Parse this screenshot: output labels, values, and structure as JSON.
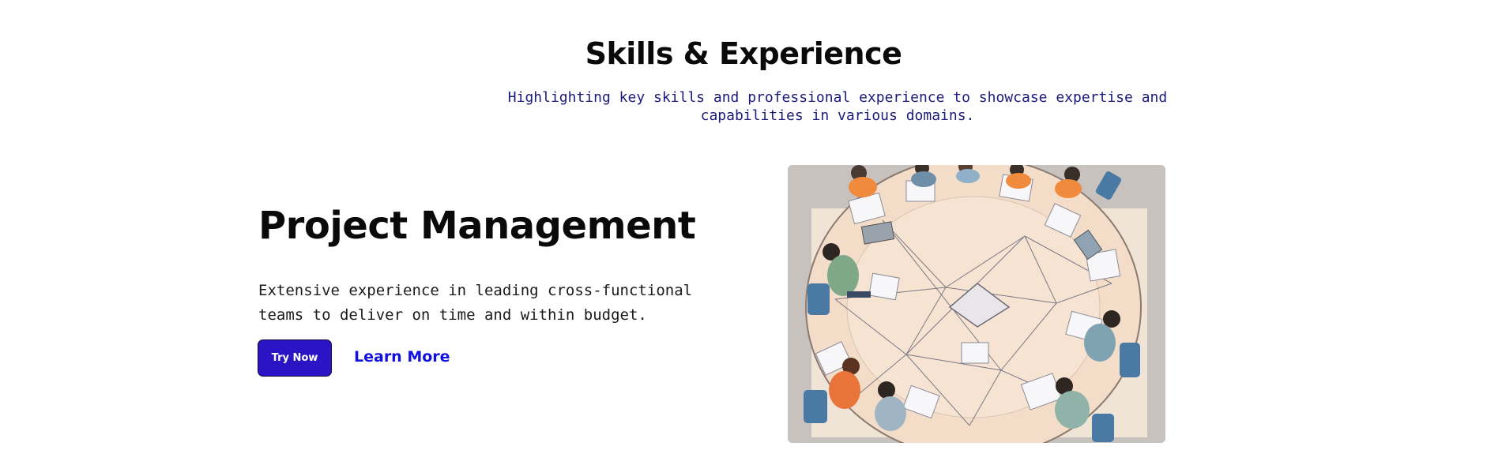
{
  "section": {
    "title": "Skills & Experience",
    "subtitle": "Highlighting key skills and professional experience to showcase expertise and capabilities in various domains."
  },
  "feature": {
    "title": "Project Management",
    "description": "Extensive experience in leading cross-functional teams to deliver on time and within budget.",
    "primary_button_label": "Try Now",
    "secondary_link_label": "Learn More",
    "image_alt": "Illustration of a team collaborating around a round table"
  },
  "colors": {
    "primary_button": "#2a14c4",
    "link": "#1010e0",
    "subtitle": "#1b1b7a",
    "heading": "#0a0a0a"
  }
}
